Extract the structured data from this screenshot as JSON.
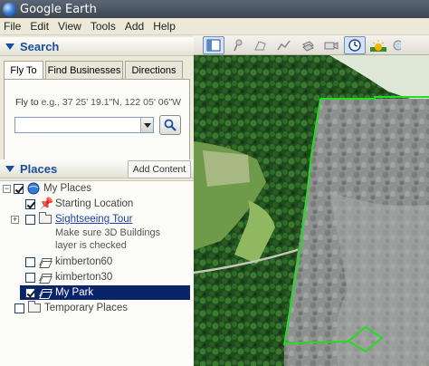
{
  "window": {
    "title": "Google Earth"
  },
  "menu": [
    "File",
    "Edit",
    "View",
    "Tools",
    "Add",
    "Help"
  ],
  "search": {
    "header": "Search",
    "tabs": [
      "Fly To",
      "Find Businesses",
      "Directions"
    ],
    "active_tab": "Fly To",
    "flyto_prefix": "Fly to",
    "flyto_example": " e.g., 37 25' 19.1\"N, 122 05' 06\"W",
    "input_value": ""
  },
  "places": {
    "header": "Places",
    "add_content": "Add Content",
    "items": [
      {
        "label": "My Places",
        "checked": true
      },
      {
        "label": "Starting Location",
        "checked": true
      },
      {
        "label": "Sightseeing Tour",
        "checked": false
      },
      {
        "label": "Make sure 3D Buildings",
        "checked": false
      },
      {
        "label": "layer is checked",
        "checked": false
      },
      {
        "label": "kimberton60",
        "checked": false
      },
      {
        "label": "kimberton30",
        "checked": false
      },
      {
        "label": "My Park",
        "checked": true,
        "selected": true
      },
      {
        "label": "Temporary Places",
        "checked": false
      }
    ]
  },
  "map": {
    "toolbar_icons": [
      "sidebar-toggle-icon",
      "placemark-icon",
      "polygon-icon",
      "path-icon",
      "image-overlay-icon",
      "record-tour-icon",
      "historical-imagery-icon",
      "sunlight-icon",
      "planets-icon"
    ],
    "overlay_outline_color": "#22dd22"
  },
  "colors": {
    "accent": "#1b4e9b",
    "selection": "#0a246a"
  }
}
